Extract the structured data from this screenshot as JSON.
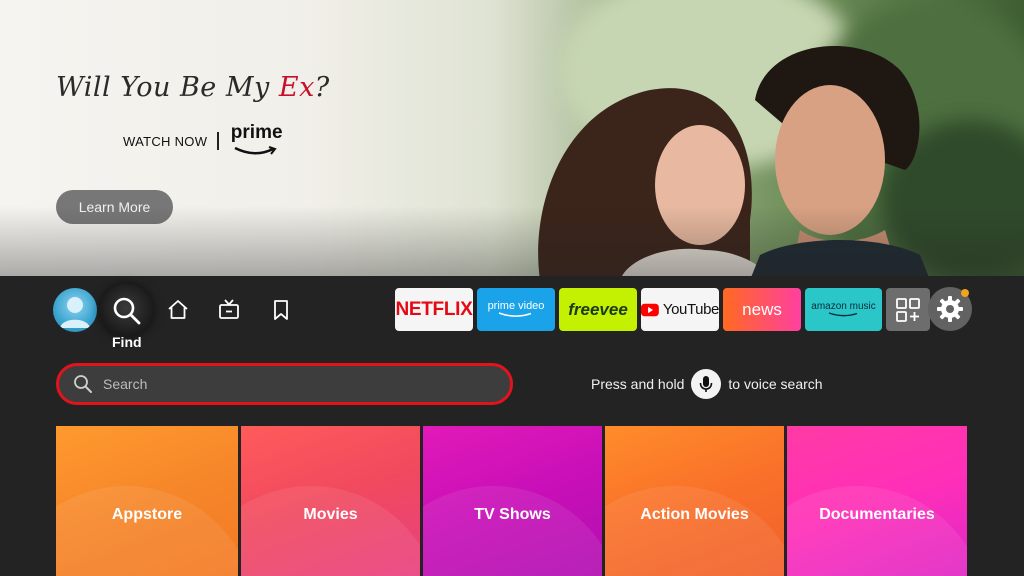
{
  "hero": {
    "title_part1": "Will You Be My ",
    "title_accent": "Ex",
    "title_end": "?",
    "watch_now": "WATCH NOW",
    "prime": "prime",
    "learn_more": "Learn More"
  },
  "nav": {
    "find_label": "Find",
    "apps": {
      "netflix": "NETFLIX",
      "primevideo": "prime video",
      "freevee": "freevee",
      "youtube": "YouTube",
      "news": "news",
      "amazonmusic": "amazon music"
    }
  },
  "search": {
    "placeholder": "Search",
    "voice_before": "Press and hold",
    "voice_after": "to voice search"
  },
  "tiles": [
    "Appstore",
    "Movies",
    "TV Shows",
    "Action Movies",
    "Documentaries"
  ],
  "colors": {
    "search_focus_border": "#e1141e",
    "notification_dot": "#f3a21a"
  }
}
